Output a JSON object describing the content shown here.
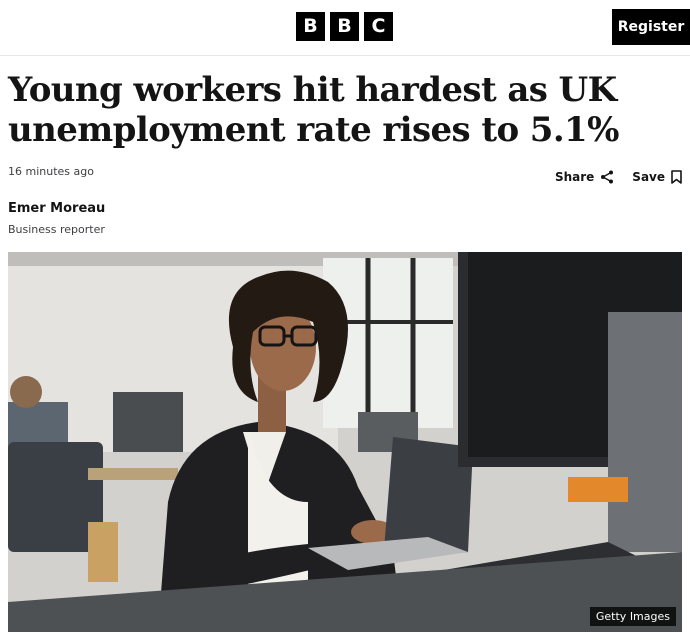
{
  "header": {
    "logo_letters": [
      "B",
      "B",
      "C"
    ],
    "register_label": "Register"
  },
  "article": {
    "headline": "Young workers hit hardest as UK unemployment rate rises to 5.1%",
    "timestamp": "16 minutes ago",
    "share_label": "Share",
    "save_label": "Save",
    "author_name": "Emer Moreau",
    "author_role": "Business reporter"
  },
  "image": {
    "credit": "Getty Images",
    "icon": "woman-at-laptop-photo"
  },
  "icons": {
    "share": "share-icon",
    "save": "bookmark-icon"
  }
}
